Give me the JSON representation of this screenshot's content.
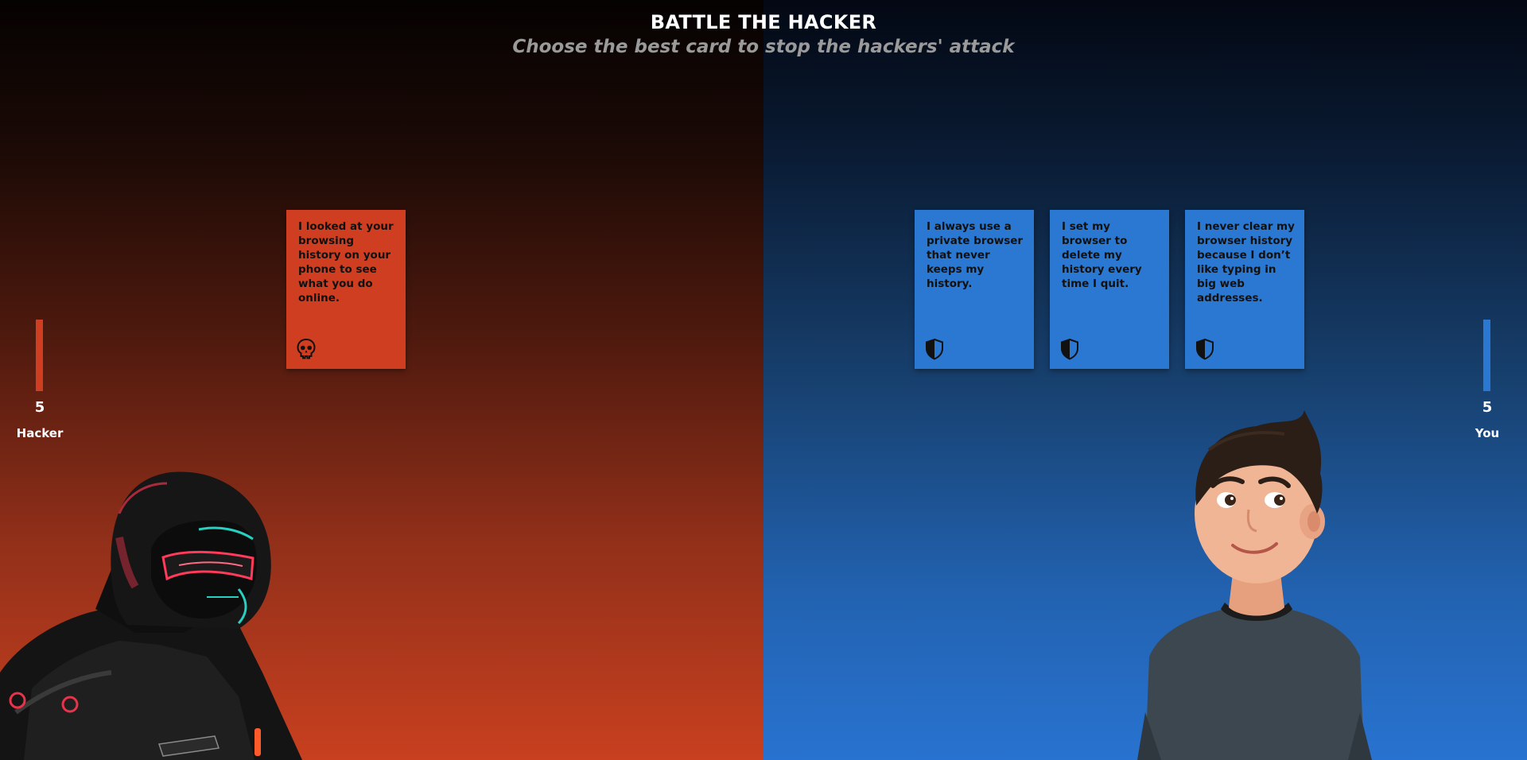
{
  "header": {
    "title": "BATTLE THE HACKER",
    "subtitle": "Choose the best card to stop the hackers' attack"
  },
  "colors": {
    "attack_card": "#d03e21",
    "defense_card": "#2a78d2",
    "hacker_meter": "#d03e21",
    "player_meter": "#2a78d2"
  },
  "hacker": {
    "label": "Hacker",
    "score": "5",
    "portrait_icon": "hooded-hacker-figure"
  },
  "player": {
    "label": "You",
    "score": "5",
    "portrait_icon": "smiling-boy-figure"
  },
  "attack_card": {
    "text": "I looked at your browsing history on your phone to see what you do online.",
    "icon": "skull-icon"
  },
  "defense_cards": [
    {
      "text": "I always use a private browser that never keeps my history.",
      "icon": "shield-icon"
    },
    {
      "text": "I set my browser to delete my history every time I quit.",
      "icon": "shield-icon"
    },
    {
      "text": "I never clear my browser history because I don’t like typing in big web addresses.",
      "icon": "shield-icon"
    }
  ]
}
